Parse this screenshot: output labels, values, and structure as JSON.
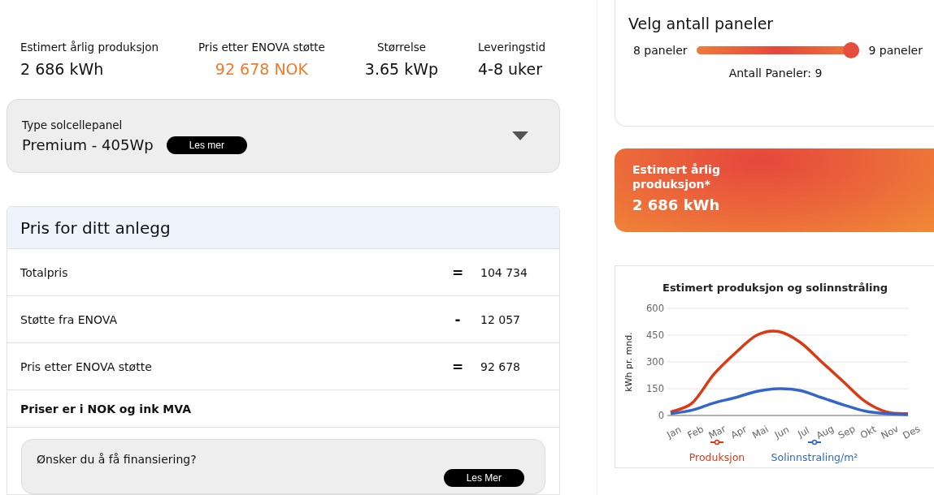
{
  "stats": [
    {
      "label": "Estimert årlig produksjon",
      "value": "2 686 kWh",
      "highlight": false
    },
    {
      "label": "Pris etter ENOVA støtte",
      "value": "92 678 NOK",
      "highlight": true
    },
    {
      "label": "Størrelse",
      "value": "3.65 kWp",
      "highlight": false
    },
    {
      "label": "Leveringstid",
      "value": "4-8 uker",
      "highlight": false
    }
  ],
  "panel_type": {
    "label": "Type solcellepanel",
    "value": "Premium - 405Wp",
    "button": "Les mer"
  },
  "price": {
    "title": "Pris for ditt anlegg",
    "rows": [
      {
        "label": "Totalpris",
        "operator": "=",
        "amount": "104 734"
      },
      {
        "label": "Støtte fra ENOVA",
        "operator": "-",
        "amount": "12 057"
      },
      {
        "label": "Pris etter ENOVA støtte",
        "operator": "=",
        "amount": "92 678"
      }
    ],
    "note": "Priser er i NOK og ink MVA",
    "financing": {
      "question": "Ønsker du å få finansiering?",
      "button": "Les Mer"
    }
  },
  "panels": {
    "title": "Velg antall paneler",
    "min_label": "8 paneler",
    "max_label": "9 paneler",
    "level": 1,
    "reading": "Antall Paneler: 9"
  },
  "production_card": {
    "label": "Estimert årlig produksjon*",
    "value": "2 686 kWh"
  },
  "chart": {
    "chart_data": {
      "type": "line",
      "title": "Estimert produksjon og solinnstråling",
      "ylabel": "kWh pr. mnd.",
      "categories": [
        "Jan",
        "Feb",
        "Mar",
        "Apr",
        "Mai",
        "Jun",
        "Jul",
        "Aug",
        "Sep",
        "Okt",
        "Nov",
        "Des"
      ],
      "ylim": [
        0,
        600
      ],
      "grid": true,
      "legend": true,
      "yticks": [
        0,
        150,
        300,
        450,
        600
      ],
      "series": [
        {
          "name": "Produksjon",
          "color": "#dc3912",
          "values": [
            20,
            70,
            230,
            350,
            450,
            470,
            410,
            300,
            190,
            80,
            20,
            10
          ]
        },
        {
          "name": "Solinnstraling/m²",
          "color": "#3366cc",
          "values": [
            10,
            30,
            70,
            100,
            135,
            150,
            140,
            100,
            60,
            25,
            10,
            5
          ]
        }
      ]
    }
  }
}
